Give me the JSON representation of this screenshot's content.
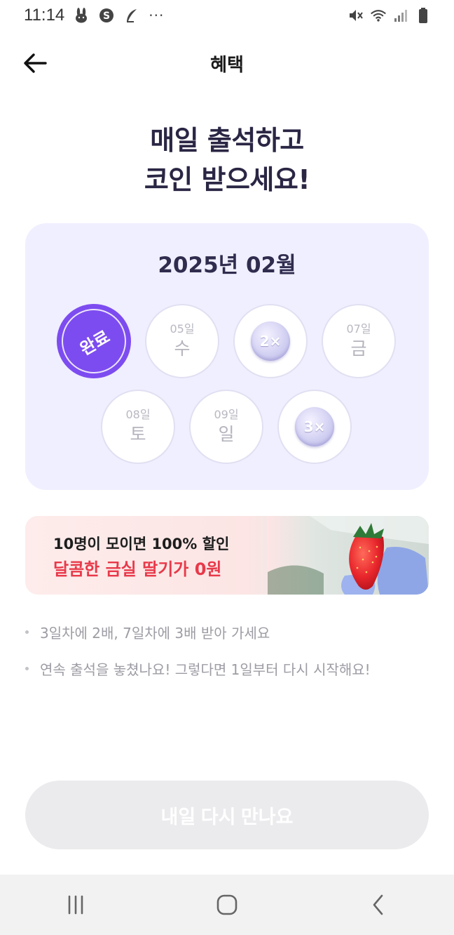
{
  "status_bar": {
    "time": "11:14",
    "more": "···",
    "left_icons": [
      "rabbit-icon",
      "s-circle-icon",
      "feather-icon"
    ],
    "right_icons": [
      "mute-icon",
      "wifi-icon",
      "signal-icon",
      "battery-icon"
    ]
  },
  "header": {
    "title": "혜택",
    "back_icon": "arrow-left-icon"
  },
  "hero": {
    "line1": "매일 출석하고",
    "line2": "코인 받으세요!"
  },
  "calendar": {
    "month_label": "2025년 02월",
    "days": [
      {
        "status": "done",
        "label": "완료"
      },
      {
        "date": "05일",
        "weekday": "수"
      },
      {
        "reward": "2×"
      },
      {
        "date": "07일",
        "weekday": "금"
      },
      {
        "date": "08일",
        "weekday": "토"
      },
      {
        "date": "09일",
        "weekday": "일"
      },
      {
        "reward": "3×"
      }
    ]
  },
  "banner": {
    "line1": "10명이 모이면 100% 할인",
    "line2": "달콤한 금실 딸기가 0원",
    "image": "strawberry-in-gloved-hand"
  },
  "notes": [
    "3일차에 2배, 7일차에 3배 받아 가세요",
    "연속 출석을 놓쳤나요! 그렇다면 1일부터 다시 시작해요!"
  ],
  "cta": {
    "label": "내일 다시 만나요",
    "state": "disabled"
  },
  "colors": {
    "accent": "#7d4cf0",
    "card_bg": "#f0efff",
    "banner_highlight": "#e8394a",
    "hero_text": "#2a2644"
  },
  "nav_bar": {
    "icons": [
      "recent-apps-icon",
      "home-icon",
      "back-icon"
    ]
  }
}
